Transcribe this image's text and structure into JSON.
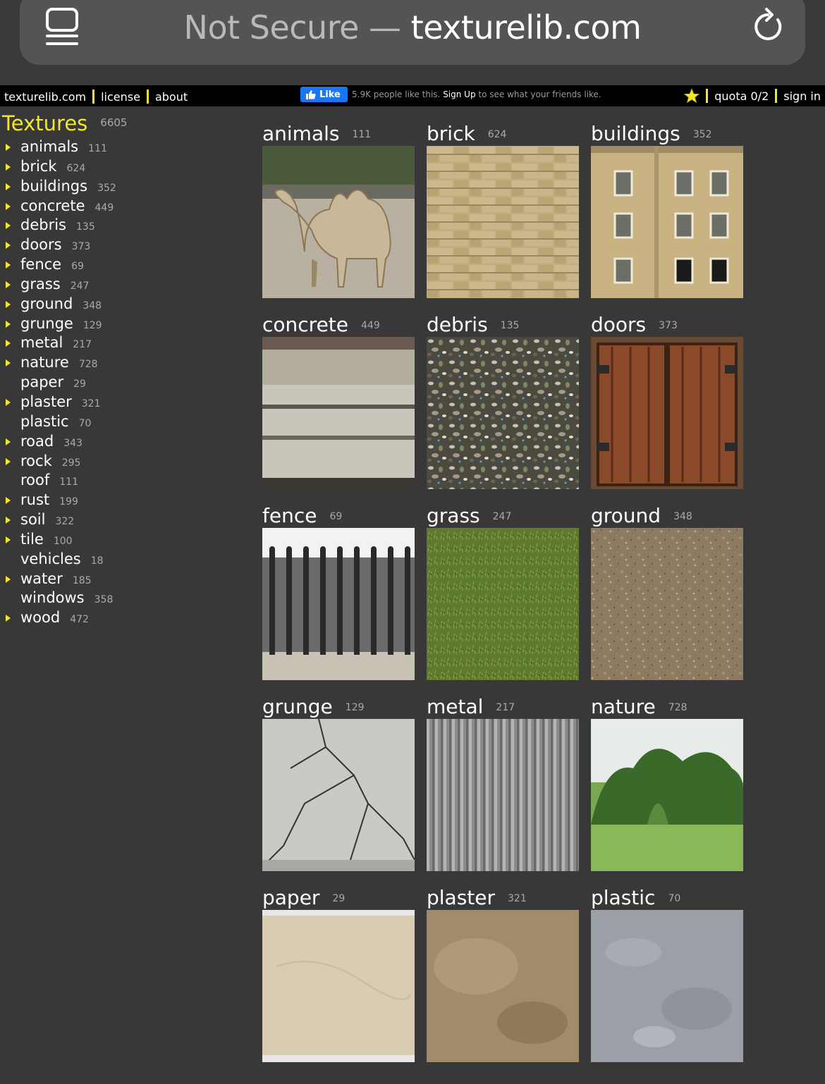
{
  "browser": {
    "url_prefix": "Not Secure — ",
    "url_host": "texturelib.com"
  },
  "topbar": {
    "site": "texturelib.com",
    "license": "license",
    "about": "about",
    "fb_like": "Like",
    "fb_count_text": "5.9K people like this.",
    "fb_signup": "Sign Up",
    "fb_rest": "to see what your friends like.",
    "quota": "quota 0/2",
    "signin": "sign in"
  },
  "sidebar": {
    "title": "Textures",
    "total": "6605",
    "items": [
      {
        "label": "animals",
        "count": "111",
        "arrow": true
      },
      {
        "label": "brick",
        "count": "624",
        "arrow": true
      },
      {
        "label": "buildings",
        "count": "352",
        "arrow": true
      },
      {
        "label": "concrete",
        "count": "449",
        "arrow": true
      },
      {
        "label": "debris",
        "count": "135",
        "arrow": true
      },
      {
        "label": "doors",
        "count": "373",
        "arrow": true
      },
      {
        "label": "fence",
        "count": "69",
        "arrow": true
      },
      {
        "label": "grass",
        "count": "247",
        "arrow": true
      },
      {
        "label": "ground",
        "count": "348",
        "arrow": true
      },
      {
        "label": "grunge",
        "count": "129",
        "arrow": true
      },
      {
        "label": "metal",
        "count": "217",
        "arrow": true
      },
      {
        "label": "nature",
        "count": "728",
        "arrow": true
      },
      {
        "label": "paper",
        "count": "29",
        "arrow": false
      },
      {
        "label": "plaster",
        "count": "321",
        "arrow": true
      },
      {
        "label": "plastic",
        "count": "70",
        "arrow": false
      },
      {
        "label": "road",
        "count": "343",
        "arrow": true
      },
      {
        "label": "rock",
        "count": "295",
        "arrow": true
      },
      {
        "label": "roof",
        "count": "111",
        "arrow": false
      },
      {
        "label": "rust",
        "count": "199",
        "arrow": true
      },
      {
        "label": "soil",
        "count": "322",
        "arrow": true
      },
      {
        "label": "tile",
        "count": "100",
        "arrow": true
      },
      {
        "label": "vehicles",
        "count": "18",
        "arrow": false
      },
      {
        "label": "water",
        "count": "185",
        "arrow": true
      },
      {
        "label": "windows",
        "count": "358",
        "arrow": false
      },
      {
        "label": "wood",
        "count": "472",
        "arrow": true
      }
    ]
  },
  "grid": [
    {
      "label": "animals",
      "count": "111",
      "thumb": "camel"
    },
    {
      "label": "brick",
      "count": "624",
      "thumb": "stone-wall"
    },
    {
      "label": "buildings",
      "count": "352",
      "thumb": "facade"
    },
    {
      "label": "concrete",
      "count": "449",
      "thumb": "concrete"
    },
    {
      "label": "debris",
      "count": "135",
      "thumb": "rubble"
    },
    {
      "label": "doors",
      "count": "373",
      "thumb": "wood-doors"
    },
    {
      "label": "fence",
      "count": "69",
      "thumb": "iron-fence"
    },
    {
      "label": "grass",
      "count": "247",
      "thumb": "grass"
    },
    {
      "label": "ground",
      "count": "348",
      "thumb": "gravel"
    },
    {
      "label": "grunge",
      "count": "129",
      "thumb": "cracked"
    },
    {
      "label": "metal",
      "count": "217",
      "thumb": "corrugated"
    },
    {
      "label": "nature",
      "count": "728",
      "thumb": "trees"
    },
    {
      "label": "paper",
      "count": "29",
      "thumb": "paper"
    },
    {
      "label": "plaster",
      "count": "321",
      "thumb": "plaster"
    },
    {
      "label": "plastic",
      "count": "70",
      "thumb": "grey-plastic"
    }
  ],
  "colors": {
    "accent": "#f3e62b",
    "background": "#383838",
    "topbar": "#000000",
    "facebook": "#1877f2"
  }
}
